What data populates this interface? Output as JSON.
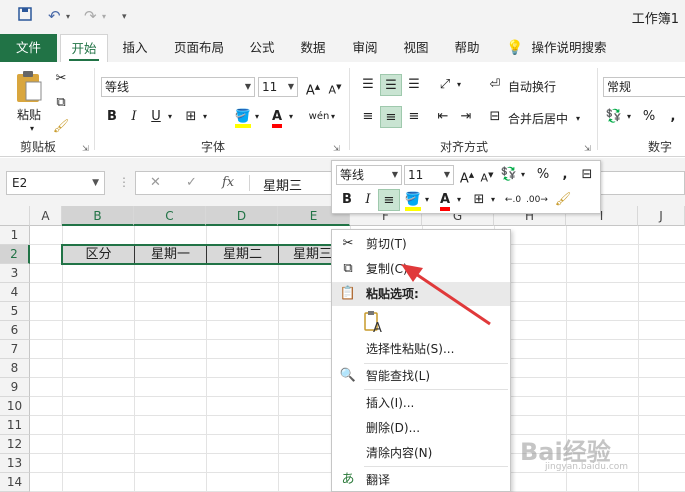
{
  "window": {
    "title": "工作簿1"
  },
  "quick_access": {
    "save_icon": "save-icon",
    "undo_icon": "undo-icon",
    "redo_icon": "redo-icon",
    "customize_icon": "customize-icon"
  },
  "tabs": [
    "文件",
    "开始",
    "插入",
    "页面布局",
    "公式",
    "数据",
    "审阅",
    "视图",
    "帮助"
  ],
  "active_tab": "开始",
  "tell_me": "操作说明搜索",
  "ribbon": {
    "clipboard": {
      "paste_label": "粘贴",
      "group_label": "剪贴板"
    },
    "font": {
      "font_name": "等线",
      "font_size": "11",
      "group_label": "字体"
    },
    "alignment": {
      "wrap_text": "自动换行",
      "merge_center": "合并后居中",
      "group_label": "对齐方式"
    },
    "number": {
      "format": "常规",
      "group_label": "数字"
    }
  },
  "formula_bar": {
    "name_box": "E2",
    "content": "星期三"
  },
  "columns": [
    "A",
    "B",
    "C",
    "D",
    "E",
    "F",
    "G",
    "H",
    "I",
    "J"
  ],
  "rows": [
    "1",
    "2",
    "3",
    "4",
    "5",
    "6",
    "7",
    "8",
    "9",
    "10",
    "11",
    "12",
    "13",
    "14"
  ],
  "cells": {
    "B2": "区分",
    "C2": "星期一",
    "D2": "星期二",
    "E2": "星期三"
  },
  "mini_toolbar": {
    "font_name": "等线",
    "font_size": "11"
  },
  "context_menu": {
    "items": [
      {
        "label": "剪切(T)",
        "icon": "cut-icon"
      },
      {
        "label": "复制(C)",
        "icon": "copy-icon"
      },
      {
        "label": "粘贴选项:",
        "icon": "paste-icon"
      },
      {
        "label": "选择性粘贴(S)...",
        "icon": ""
      },
      {
        "label": "智能查找(L)",
        "icon": "smart-lookup-icon"
      },
      {
        "label": "插入(I)...",
        "icon": ""
      },
      {
        "label": "删除(D)...",
        "icon": ""
      },
      {
        "label": "清除内容(N)",
        "icon": ""
      },
      {
        "label": "翻译",
        "icon": "translate-icon"
      }
    ]
  },
  "colors": {
    "excel_green": "#217346",
    "arrow_red": "#e0393a",
    "selection_green": "#c9e4d2"
  },
  "watermark": {
    "brand": "Bai经验",
    "url": "jingyan.baidu.com"
  }
}
